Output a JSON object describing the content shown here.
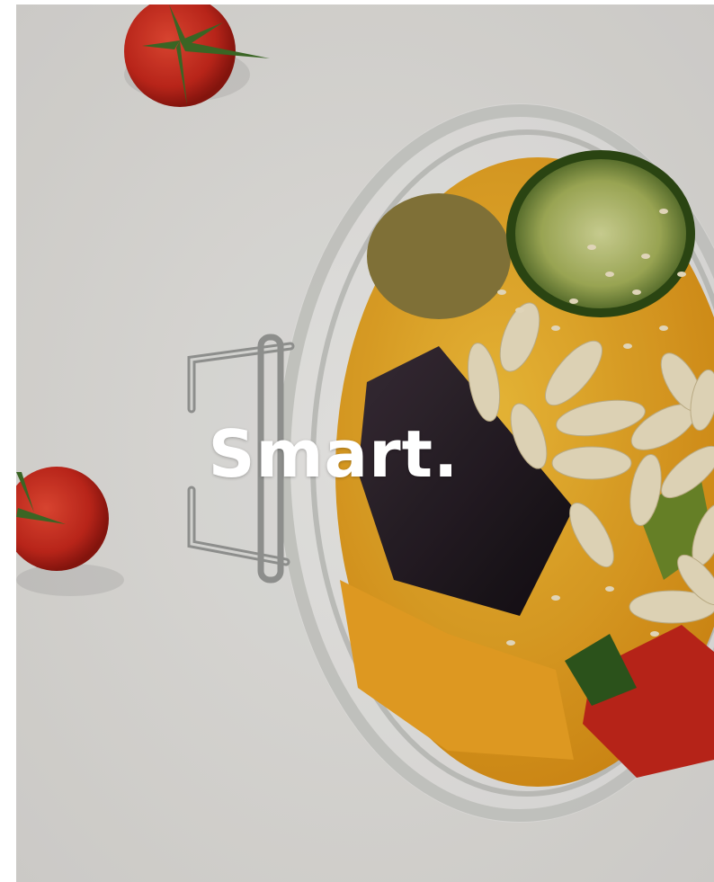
{
  "hero": {
    "headline": "Smart.",
    "image_subject": "overhead-glass-jar-of-roasted-vegetables-with-pine-nuts-and-cherry-tomatoes",
    "overlay_color": "#000000"
  },
  "colors": {
    "background": "#e8e6e3",
    "tomato": "#c7281c",
    "pepper_yellow": "#e9a51a",
    "eggplant": "#1f1820",
    "zucchini": "#5a7a2a"
  }
}
